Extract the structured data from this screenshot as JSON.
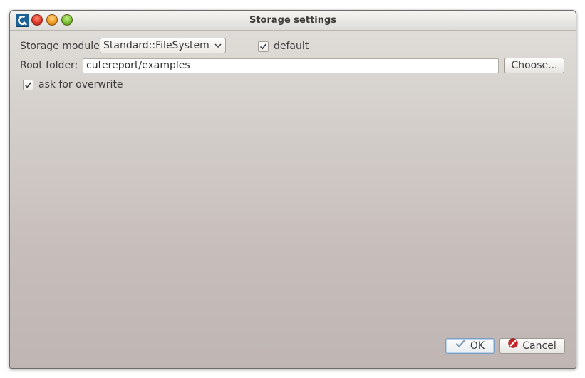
{
  "window": {
    "title": "Storage settings"
  },
  "storage_module": {
    "label": "Storage module:",
    "selected": "Standard::FileSystem",
    "default_label": "default",
    "default_checked": true
  },
  "root_folder": {
    "label": "Root folder:",
    "value": "cutereport/examples",
    "choose_label": "Choose..."
  },
  "overwrite": {
    "label": "ask for overwrite",
    "checked": true
  },
  "buttons": {
    "ok_label": "OK",
    "cancel_label": "Cancel"
  },
  "icons": {
    "app": "cutereport-app-icon",
    "ok": "checkmark-icon",
    "cancel": "cancel-icon"
  }
}
